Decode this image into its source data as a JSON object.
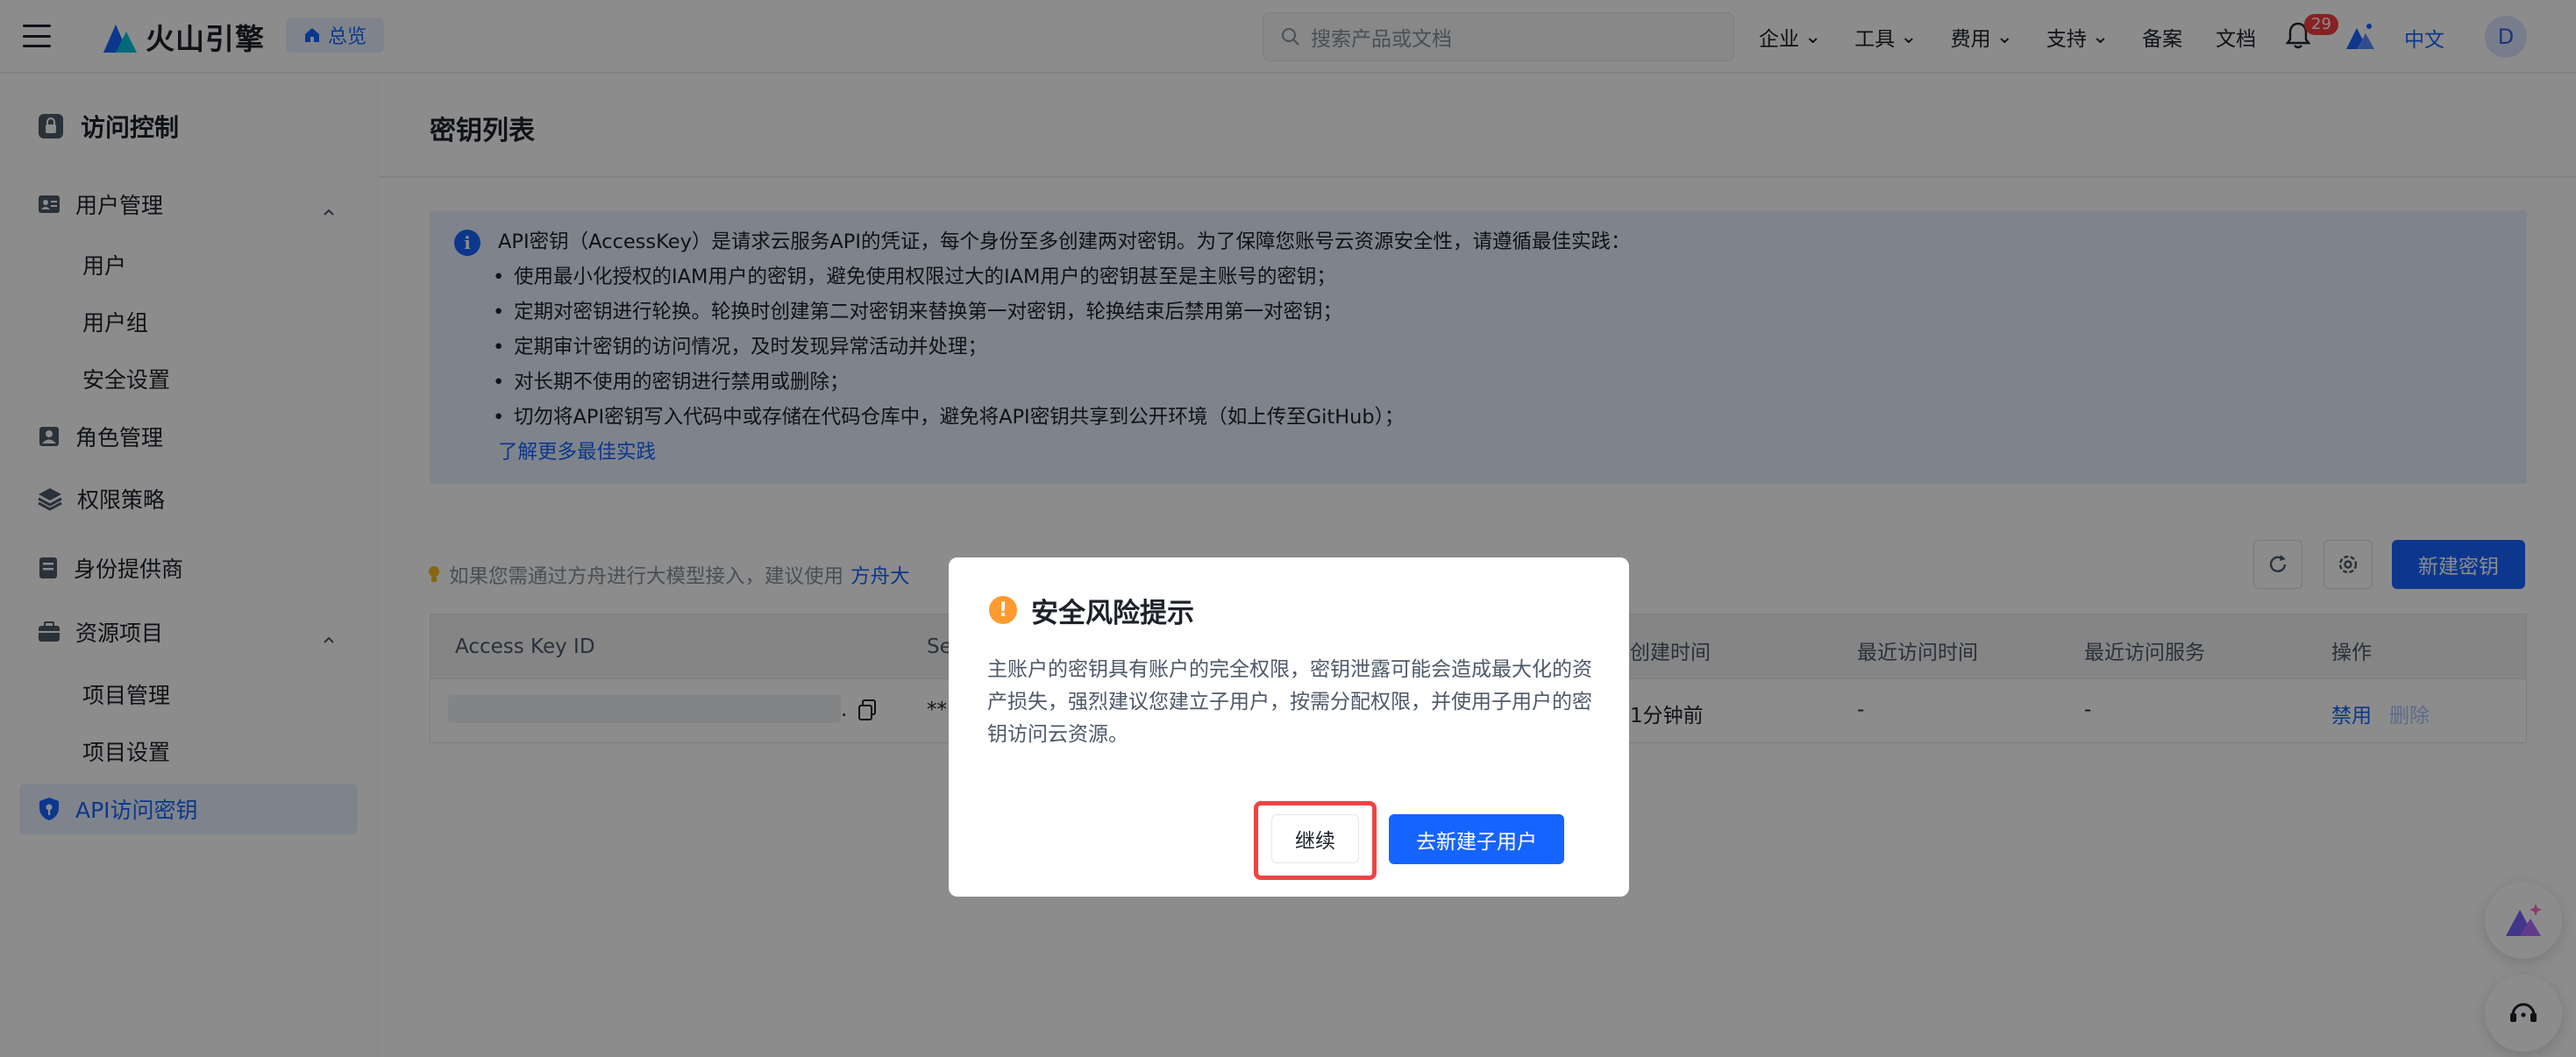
{
  "topbar": {
    "brand": "火山引擎",
    "overview": "总览",
    "search_placeholder": "搜索产品或文档",
    "nav": [
      "企业",
      "工具",
      "费用",
      "支持"
    ],
    "nav_plain": [
      "备案",
      "文档"
    ],
    "notification_count": "29",
    "language": "中文",
    "avatar_initial": "D"
  },
  "sidebar": {
    "title": "访问控制",
    "user_mgmt": "用户管理",
    "user_subs": [
      "用户",
      "用户组",
      "安全设置"
    ],
    "role_mgmt": "角色管理",
    "policy": "权限策略",
    "idp": "身份提供商",
    "resource": "资源项目",
    "resource_subs": [
      "项目管理",
      "项目设置"
    ],
    "api_keys": "API访问密钥"
  },
  "main": {
    "title": "密钥列表",
    "info_intro": "API密钥（AccessKey）是请求云服务API的凭证，每个身份至多创建两对密钥。为了保障您账号云资源安全性，请遵循最佳实践：",
    "info_bullets": [
      "使用最小化授权的IAM用户的密钥，避免使用权限过大的IAM用户的密钥甚至是主账号的密钥；",
      "定期对密钥进行轮换。轮换时创建第二对密钥来替换第一对密钥，轮换结束后禁用第一对密钥；",
      "定期审计密钥的访问情况，及时发现异常活动并处理；",
      "对长期不使用的密钥进行禁用或删除；",
      "切勿将API密钥写入代码中或存储在代码仓库中，避免将API密钥共享到公开环境（如上传至GitHub）；"
    ],
    "learn_more": "了解更多最佳实践",
    "tip_text": "如果您需通过方舟进行大模型接入，建议使用",
    "tip_link": "方舟大",
    "new_key": "新建密钥",
    "table": {
      "headers": {
        "access_key_id": "Access Key ID",
        "secret": "Se",
        "created": "创建时间",
        "last_access": "最近访问时间",
        "last_service": "最近访问服务",
        "actions": "操作"
      },
      "row": {
        "access_key_suffix": ".",
        "secret": "**",
        "created": "1分钟前",
        "last_access": "-",
        "last_service": "-",
        "disable": "禁用",
        "delete": "删除"
      }
    }
  },
  "modal": {
    "title": "安全风险提示",
    "body": "主账户的密钥具有账户的完全权限，密钥泄露可能会造成最大化的资产损失，强烈建议您建立子用户，按需分配权限，并使用子用户的密钥访问云资源。",
    "continue": "继续",
    "create_sub_user": "去新建子用户"
  },
  "colors": {
    "primary": "#1664ff",
    "warning": "#ff9a2e",
    "highlight_border": "#f04444"
  }
}
